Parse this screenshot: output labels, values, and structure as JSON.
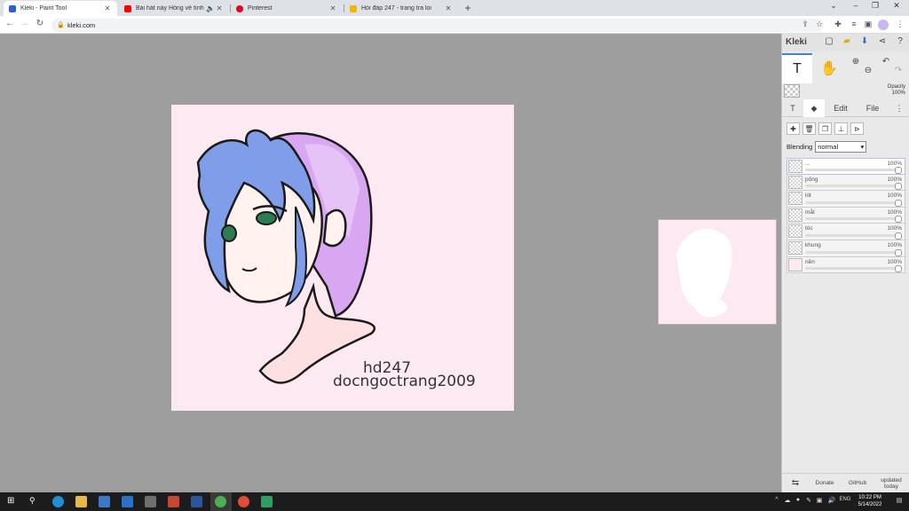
{
  "browser": {
    "tabs": [
      {
        "title": "Kleki - Paint Tool",
        "favicon_color": "#2b5fcf",
        "active": true
      },
      {
        "title": "Bài hát này Hồng về tình iu.",
        "favicon_color": "#ff0000",
        "active": false
      },
      {
        "title": "Pinterest",
        "favicon_color": "#e60023",
        "active": false
      },
      {
        "title": "Hỏi đáp 247 - trang tra loi",
        "favicon_color": "#f2b705",
        "active": false
      }
    ],
    "address": "kleki.com"
  },
  "artwork": {
    "watermark_line1": "hd247",
    "watermark_line2": "docngoctrang2009",
    "background_color": "#fde9f1"
  },
  "panel": {
    "logo": "Kleki",
    "opacity_label": "Opacity",
    "opacity_value": "100%",
    "tabs": {
      "edit": "Edit",
      "file": "File"
    },
    "blending_label": "Blending",
    "blending_value": "normal",
    "layers": [
      {
        "name": "...",
        "opacity": "100%",
        "selected": true
      },
      {
        "name": "pông",
        "opacity": "100%",
        "selected": false
      },
      {
        "name": "lót",
        "opacity": "100%",
        "selected": false
      },
      {
        "name": "mắt",
        "opacity": "100%",
        "selected": false
      },
      {
        "name": "tóc",
        "opacity": "100%",
        "selected": false
      },
      {
        "name": "khung",
        "opacity": "100%",
        "selected": false
      },
      {
        "name": "nền",
        "opacity": "100%",
        "selected": false
      }
    ],
    "footer": {
      "donate": "Donate",
      "github": "GitHub",
      "updated": "updated today"
    }
  },
  "taskbar": {
    "lang": "ENG",
    "time": "10:22 PM",
    "date": "5/14/2022"
  }
}
